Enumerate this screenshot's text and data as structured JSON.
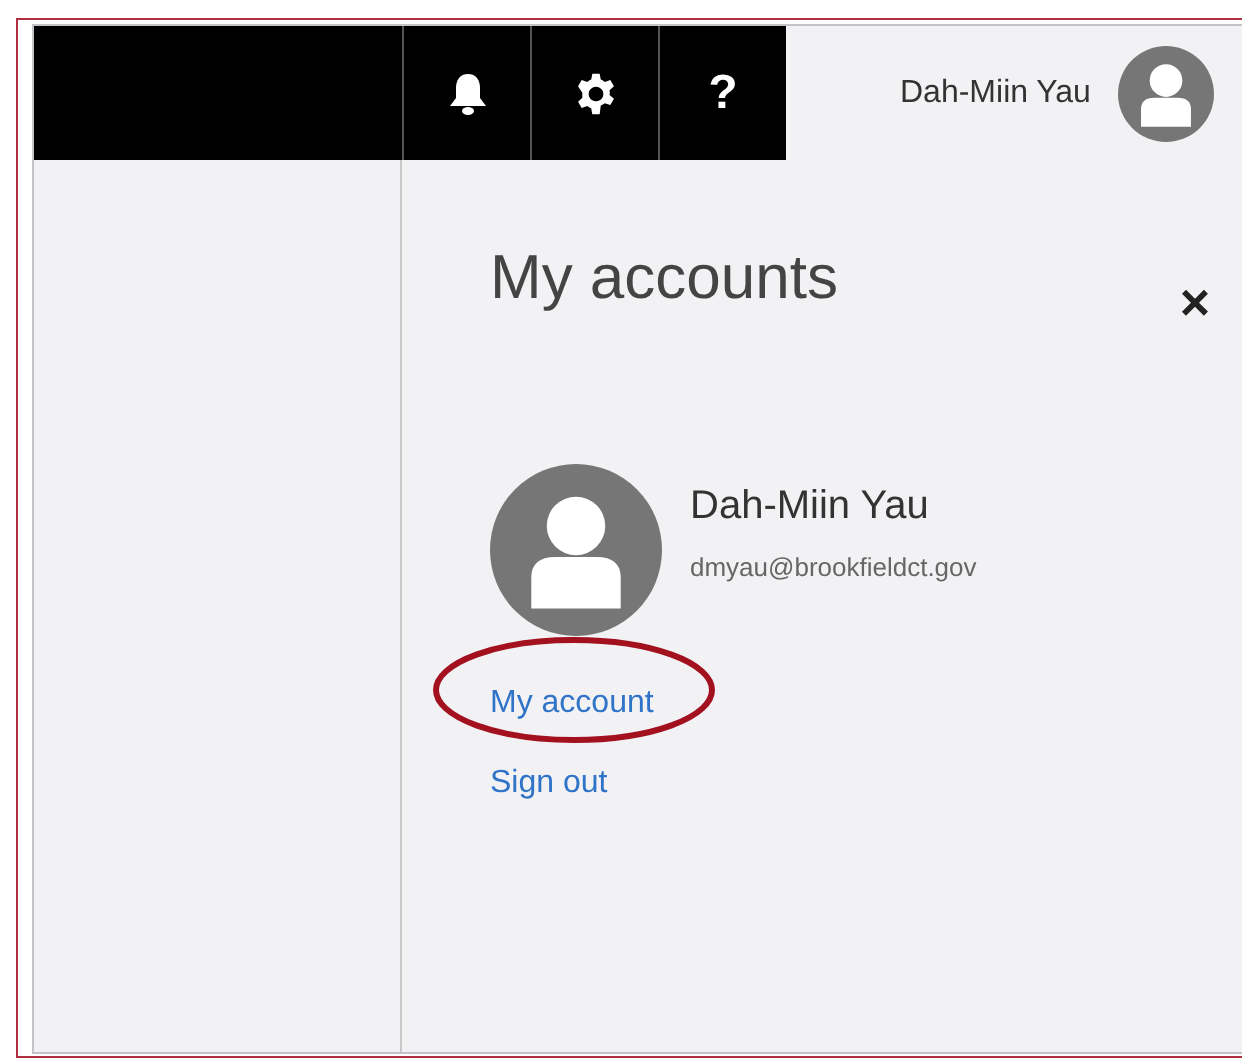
{
  "top_bar": {
    "buttons": [
      {
        "kind": "bell"
      },
      {
        "kind": "gear"
      },
      {
        "kind": "help",
        "label": "?"
      }
    ],
    "user_name": "Dah-Miin Yau"
  },
  "accounts_panel": {
    "title": "My accounts",
    "close": "×",
    "name": "Dah-Miin Yau",
    "email": "dmyau@brookfieldct.gov",
    "links": [
      {
        "label": "My account",
        "highlighted": true
      },
      {
        "label": "Sign out",
        "highlighted": false
      }
    ]
  }
}
